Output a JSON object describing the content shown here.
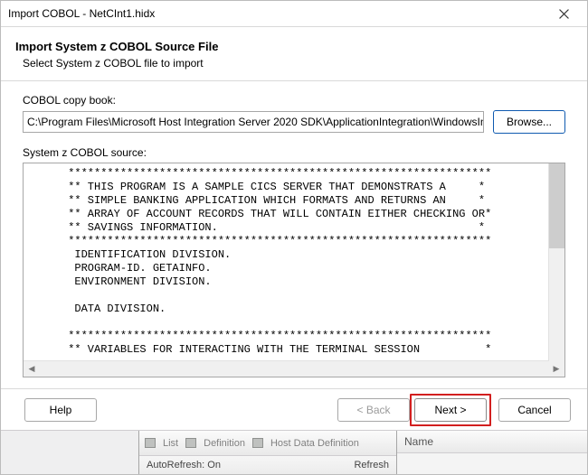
{
  "window": {
    "title": "Import COBOL - NetCInt1.hidx"
  },
  "header": {
    "title": "Import System z COBOL Source File",
    "subtitle": "Select System z COBOL file to import"
  },
  "copybook": {
    "label": "COBOL copy book:",
    "path": "C:\\Program Files\\Microsoft Host Integration Server 2020 SDK\\ApplicationIntegration\\WindowsInitiated\\Cics",
    "browse_label": "Browse..."
  },
  "source": {
    "label": "System z COBOL source:",
    "text": "      *****************************************************************\n      ** THIS PROGRAM IS A SAMPLE CICS SERVER THAT DEMONSTRATS A     *\n      ** SIMPLE BANKING APPLICATION WHICH FORMATS AND RETURNS AN     *\n      ** ARRAY OF ACCOUNT RECORDS THAT WILL CONTAIN EITHER CHECKING OR*\n      ** SAVINGS INFORMATION.                                        *\n      *****************************************************************\n       IDENTIFICATION DIVISION.\n       PROGRAM-ID. GETAINFO.\n       ENVIRONMENT DIVISION.\n\n       DATA DIVISION.\n\n      *****************************************************************\n      ** VARIABLES FOR INTERACTING WITH THE TERMINAL SESSION          *"
  },
  "buttons": {
    "help": "Help",
    "back": "< Back",
    "next": "Next >",
    "cancel": "Cancel"
  },
  "background": {
    "toolbar_items": [
      "List",
      "Definition",
      "Host Data Definition"
    ],
    "auto_refresh_label": "AutoRefresh: On",
    "refresh_label": "Refresh",
    "right_header": "Name"
  }
}
